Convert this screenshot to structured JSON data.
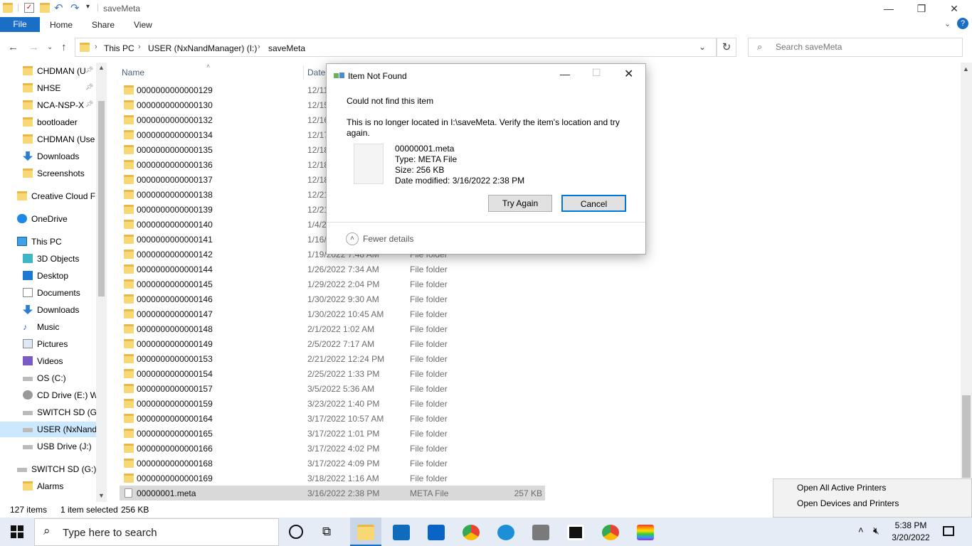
{
  "window": {
    "title": "saveMeta",
    "controls": {
      "minimize": "—",
      "maximize": "❐",
      "close": "✕"
    }
  },
  "ribbon": {
    "file_label": "File",
    "tabs": [
      "Home",
      "Share",
      "View"
    ],
    "help": "?"
  },
  "address": {
    "breadcrumbs": [
      "This PC",
      "USER (NxNandManager) (I:)",
      "saveMeta"
    ],
    "search_placeholder": "Search saveMeta"
  },
  "nav": {
    "items": [
      {
        "label": "CHDMAN (U",
        "pinned": true
      },
      {
        "label": "NHSE",
        "pinned": true
      },
      {
        "label": "NCA-NSP-X",
        "pinned": true
      },
      {
        "label": "bootloader",
        "pinned": false
      },
      {
        "label": "CHDMAN (Use",
        "pinned": false
      },
      {
        "label": "Downloads",
        "pinned": false
      },
      {
        "label": "Screenshots",
        "pinned": false
      },
      {
        "label": "Creative Cloud F",
        "pinned": false
      },
      {
        "label": "OneDrive",
        "pinned": false
      },
      {
        "label": "This PC",
        "pinned": false
      },
      {
        "label": "3D Objects",
        "pinned": false
      },
      {
        "label": "Desktop",
        "pinned": false
      },
      {
        "label": "Documents",
        "pinned": false
      },
      {
        "label": "Downloads",
        "pinned": false
      },
      {
        "label": "Music",
        "pinned": false
      },
      {
        "label": "Pictures",
        "pinned": false
      },
      {
        "label": "Videos",
        "pinned": false
      },
      {
        "label": "OS (C:)",
        "pinned": false
      },
      {
        "label": "CD Drive (E:) W",
        "pinned": false
      },
      {
        "label": "SWITCH SD (G:)",
        "pinned": false
      },
      {
        "label": "USER (NxNandI",
        "pinned": false,
        "selected": true
      },
      {
        "label": "USB Drive (J:)",
        "pinned": false
      },
      {
        "label": "SWITCH SD (G:)",
        "pinned": false
      },
      {
        "label": "Alarms",
        "pinned": false
      }
    ]
  },
  "list": {
    "headers": {
      "name": "Name",
      "date": "Date"
    },
    "rows": [
      {
        "name": "0000000000000129",
        "date": "12/11",
        "type": "",
        "size": ""
      },
      {
        "name": "0000000000000130",
        "date": "12/15",
        "type": "",
        "size": ""
      },
      {
        "name": "0000000000000132",
        "date": "12/16",
        "type": "",
        "size": ""
      },
      {
        "name": "0000000000000134",
        "date": "12/17",
        "type": "",
        "size": ""
      },
      {
        "name": "0000000000000135",
        "date": "12/18",
        "type": "",
        "size": ""
      },
      {
        "name": "0000000000000136",
        "date": "12/18",
        "type": "",
        "size": ""
      },
      {
        "name": "0000000000000137",
        "date": "12/18",
        "type": "",
        "size": ""
      },
      {
        "name": "0000000000000138",
        "date": "12/21",
        "type": "",
        "size": ""
      },
      {
        "name": "0000000000000139",
        "date": "12/21",
        "type": "",
        "size": ""
      },
      {
        "name": "0000000000000140",
        "date": "1/4/2",
        "type": "",
        "size": ""
      },
      {
        "name": "0000000000000141",
        "date": "1/16/",
        "type": "",
        "size": ""
      },
      {
        "name": "0000000000000142",
        "date": "1/19/2022 7:48 AM",
        "type": "File folder",
        "size": ""
      },
      {
        "name": "0000000000000144",
        "date": "1/26/2022 7:34 AM",
        "type": "File folder",
        "size": ""
      },
      {
        "name": "0000000000000145",
        "date": "1/29/2022 2:04 PM",
        "type": "File folder",
        "size": ""
      },
      {
        "name": "0000000000000146",
        "date": "1/30/2022 9:30 AM",
        "type": "File folder",
        "size": ""
      },
      {
        "name": "0000000000000147",
        "date": "1/30/2022 10:45 AM",
        "type": "File folder",
        "size": ""
      },
      {
        "name": "0000000000000148",
        "date": "2/1/2022 1:02 AM",
        "type": "File folder",
        "size": ""
      },
      {
        "name": "0000000000000149",
        "date": "2/5/2022 7:17 AM",
        "type": "File folder",
        "size": ""
      },
      {
        "name": "0000000000000153",
        "date": "2/21/2022 12:24 PM",
        "type": "File folder",
        "size": ""
      },
      {
        "name": "0000000000000154",
        "date": "2/25/2022 1:33 PM",
        "type": "File folder",
        "size": ""
      },
      {
        "name": "0000000000000157",
        "date": "3/5/2022 5:36 AM",
        "type": "File folder",
        "size": ""
      },
      {
        "name": "0000000000000159",
        "date": "3/23/2022 1:40 PM",
        "type": "File folder",
        "size": ""
      },
      {
        "name": "0000000000000164",
        "date": "3/17/2022 10:57 AM",
        "type": "File folder",
        "size": ""
      },
      {
        "name": "0000000000000165",
        "date": "3/17/2022 1:01 PM",
        "type": "File folder",
        "size": ""
      },
      {
        "name": "0000000000000166",
        "date": "3/17/2022 4:02 PM",
        "type": "File folder",
        "size": ""
      },
      {
        "name": "0000000000000168",
        "date": "3/17/2022 4:09 PM",
        "type": "File folder",
        "size": ""
      },
      {
        "name": "0000000000000169",
        "date": "3/18/2022 1:16 AM",
        "type": "File folder",
        "size": ""
      },
      {
        "name": "00000001.meta",
        "date": "3/16/2022 2:38 PM",
        "type": "META File",
        "size": "257 KB",
        "selected": true
      }
    ]
  },
  "status": {
    "count": "127 items",
    "selection": "1 item selected",
    "size": "256 KB"
  },
  "dialog": {
    "title": "Item Not Found",
    "heading": "Could not find this item",
    "message": "This is no longer located in I:\\saveMeta. Verify the item's location and try again.",
    "file_name": "00000001.meta",
    "file_type": "Type: META File",
    "file_size": "Size: 256 KB",
    "file_modified": "Date modified: 3/16/2022 2:38 PM",
    "try_again": "Try Again",
    "cancel": "Cancel",
    "fewer_details": "Fewer details"
  },
  "context_menu": {
    "items": [
      "Open All Active Printers",
      "Open Devices and Printers"
    ]
  },
  "taskbar": {
    "search_placeholder": "Type here to search",
    "time": "5:38 PM",
    "date": "3/20/2022"
  },
  "colors": {
    "accent": "#1a6ec5",
    "folder": "#f8d775",
    "selected_row": "#d9d9d9",
    "taskbar": "#e5ecf5"
  }
}
